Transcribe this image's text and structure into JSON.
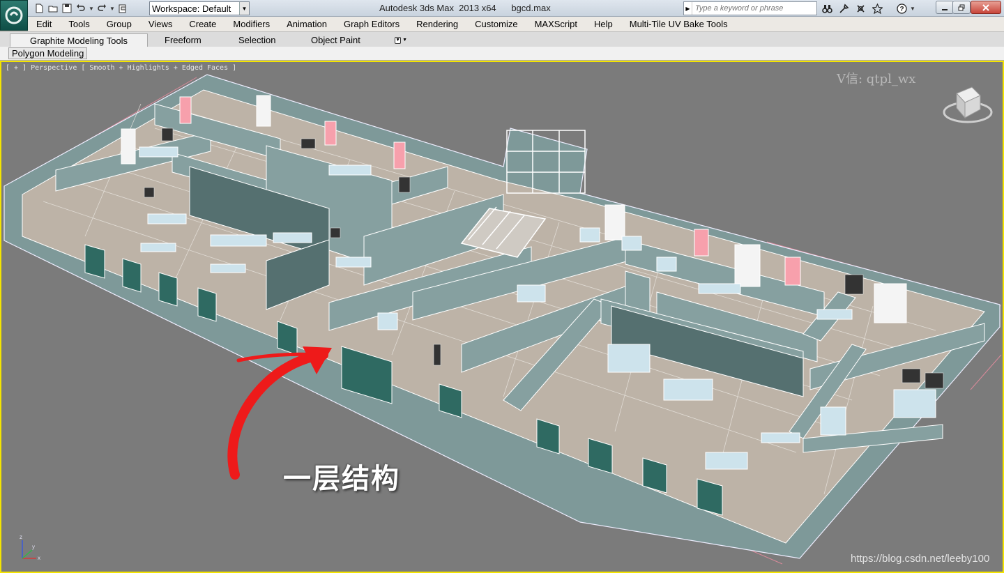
{
  "titlebar": {
    "window_title": "Autodesk 3ds Max  2013 x64      bgcd.max",
    "workspace_value": "Workspace: Default",
    "search_placeholder": "Type a keyword or phrase"
  },
  "menu": [
    "Edit",
    "Tools",
    "Group",
    "Views",
    "Create",
    "Modifiers",
    "Animation",
    "Graph Editors",
    "Rendering",
    "Customize",
    "MAXScript",
    "Help",
    "Multi-Tile UV Bake Tools"
  ],
  "ribbon": {
    "tabs": [
      "Graphite Modeling Tools",
      "Freeform",
      "Selection",
      "Object Paint"
    ],
    "panel_label": "Polygon Modeling"
  },
  "viewport": {
    "label": "[ + ] Perspective [ Smooth + Highlights + Edged Faces ]",
    "watermark_top": "V信: qtpl_wx",
    "annotation": "一层结构",
    "watermark_bottom": "https://blog.csdn.net/leeby100"
  },
  "colors": {
    "viewport_bg": "#7b7b7b",
    "viewport_border": "#f4e400",
    "wall": "#7f9b9a",
    "floor": "#bdb3a7",
    "edge": "#ffffff",
    "arrow": "#ee1a1a"
  }
}
